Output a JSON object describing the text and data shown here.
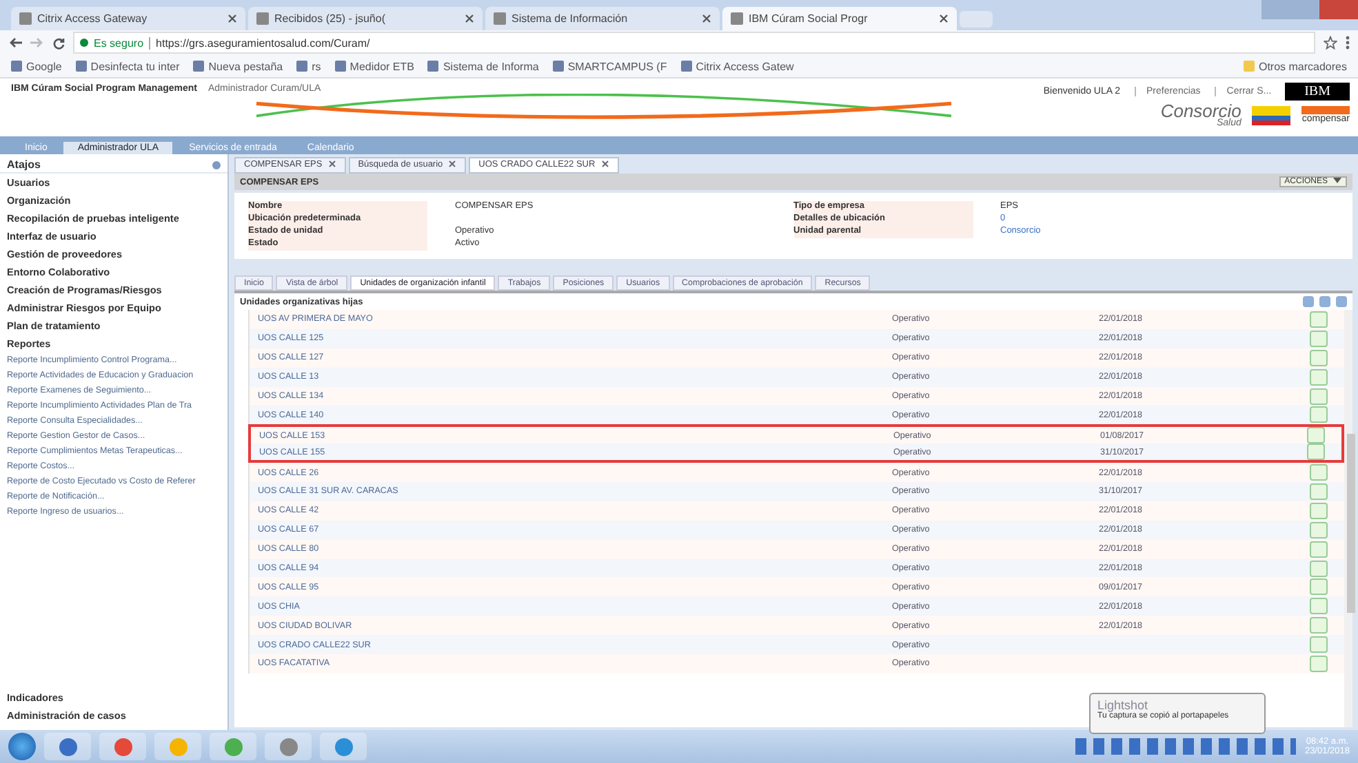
{
  "browser": {
    "tabs": [
      {
        "label": "Citrix Access Gateway",
        "selected": false
      },
      {
        "label": "Recibidos (25) - jsuño(",
        "selected": false
      },
      {
        "label": "Sistema de Información",
        "selected": false
      },
      {
        "label": "IBM Cúram Social Progr",
        "selected": true
      }
    ],
    "secure_label": "Es seguro",
    "url": "https://grs.aseguramientosalud.com/Curam/",
    "bookmarks": [
      "Google",
      "Desinfecta tu inter",
      "Nueva pestaña",
      "rs",
      "Medidor ETB",
      "Sistema de Informa",
      "SMARTCAMPUS (F",
      "Citrix Access Gatew"
    ],
    "other_bookmarks": "Otros marcadores"
  },
  "app": {
    "title": "IBM Cúram Social Program Management",
    "subtitle": "Administrador Curam/ULA",
    "welcome": "Bienvenido ULA 2",
    "links": [
      "Preferencias",
      "Cerrar S..."
    ],
    "vendor_logo": "IBM",
    "brand_logo": "Consorcio",
    "brand_logo_sub": "Salud",
    "partner_logo": "compensar",
    "nav_tabs": [
      {
        "label": "Inicio",
        "selected": false
      },
      {
        "label": "Administrador ULA",
        "selected": true
      },
      {
        "label": "Servicios de entrada",
        "selected": false
      },
      {
        "label": "Calendario",
        "selected": false
      }
    ]
  },
  "sidebar": {
    "title": "Atajos",
    "sections": [
      "Usuarios",
      "Organización",
      "Recopilación de pruebas inteligente",
      "Interfaz de usuario",
      "Gestión de proveedores",
      "Entorno Colaborativo",
      "Creación de Programas/Riesgos",
      "Administrar Riesgos por Equipo",
      "Plan de tratamiento",
      "Reportes"
    ],
    "reports": [
      "Reporte Incumplimiento Control Programa...",
      "Reporte Actividades de Educacion y Graduacion",
      "Reporte Examenes de Seguimiento...",
      "Reporte Incumplimiento Actividades Plan de Tra",
      "Reporte Consulta Especialidades...",
      "Reporte Gestion Gestor de Casos...",
      "Reporte Cumplimientos Metas Terapeuticas...",
      "Reporte Costos...",
      "Reporte de Costo Ejecutado vs Costo de Referer",
      "Reporte de Notificación...",
      "Reporte Ingreso de usuarios..."
    ],
    "bottom_sections": [
      "Indicadores",
      "Administración de casos"
    ]
  },
  "content": {
    "tabs": [
      {
        "label": "COMPENSAR EPS",
        "selected": false
      },
      {
        "label": "Búsqueda de usuario",
        "selected": false
      },
      {
        "label": "UOS CRADO CALLE22 SUR",
        "selected": true
      }
    ],
    "panel_title": "COMPENSAR EPS",
    "actions_button": "ACCIONES",
    "fields_left": [
      {
        "label": "Nombre",
        "value": "COMPENSAR EPS"
      },
      {
        "label": "Ubicación predeterminada"
      },
      {
        "label": "Estado de unidad",
        "value": "Operativo"
      },
      {
        "label": "Estado",
        "value": "Activo"
      }
    ],
    "fields_right": [
      {
        "label": "Tipo de empresa",
        "value": "EPS",
        "link": false
      },
      {
        "label": "Detalles de ubicación",
        "value": "0",
        "link": true
      },
      {
        "label": "Unidad parental",
        "value": "Consorcio",
        "link": true
      }
    ],
    "sub_tabs": [
      {
        "label": "Inicio",
        "selected": false
      },
      {
        "label": "Vista de árbol",
        "selected": false
      },
      {
        "label": "Unidades de organización infantil",
        "selected": true
      },
      {
        "label": "Trabajos",
        "selected": false
      },
      {
        "label": "Posiciones",
        "selected": false
      },
      {
        "label": "Usuarios",
        "selected": false
      },
      {
        "label": "Comprobaciones de aprobación",
        "selected": false
      },
      {
        "label": "Recursos",
        "selected": false
      }
    ],
    "section_title": "Unidades organizativas hijas",
    "rows": [
      {
        "name": "UOS AV PRIMERA DE MAYO",
        "status": "Operativo",
        "date": "22/01/2018",
        "highlighted": false
      },
      {
        "name": "UOS CALLE 125",
        "status": "Operativo",
        "date": "22/01/2018",
        "highlighted": false
      },
      {
        "name": "UOS CALLE 127",
        "status": "Operativo",
        "date": "22/01/2018",
        "highlighted": false
      },
      {
        "name": "UOS CALLE 13",
        "status": "Operativo",
        "date": "22/01/2018",
        "highlighted": false
      },
      {
        "name": "UOS CALLE 134",
        "status": "Operativo",
        "date": "22/01/2018",
        "highlighted": false
      },
      {
        "name": "UOS CALLE 140",
        "status": "Operativo",
        "date": "22/01/2018",
        "highlighted": false
      },
      {
        "name": "UOS CALLE 153",
        "status": "Operativo",
        "date": "01/08/2017",
        "highlighted": true
      },
      {
        "name": "UOS CALLE 155",
        "status": "Operativo",
        "date": "31/10/2017",
        "highlighted": true
      },
      {
        "name": "UOS CALLE 26",
        "status": "Operativo",
        "date": "22/01/2018",
        "highlighted": false
      },
      {
        "name": "UOS CALLE 31 SUR AV. CARACAS",
        "status": "Operativo",
        "date": "31/10/2017",
        "highlighted": false
      },
      {
        "name": "UOS CALLE 42",
        "status": "Operativo",
        "date": "22/01/2018",
        "highlighted": false
      },
      {
        "name": "UOS CALLE 67",
        "status": "Operativo",
        "date": "22/01/2018",
        "highlighted": false
      },
      {
        "name": "UOS CALLE 80",
        "status": "Operativo",
        "date": "22/01/2018",
        "highlighted": false
      },
      {
        "name": "UOS CALLE 94",
        "status": "Operativo",
        "date": "22/01/2018",
        "highlighted": false
      },
      {
        "name": "UOS CALLE 95",
        "status": "Operativo",
        "date": "09/01/2017",
        "highlighted": false
      },
      {
        "name": "UOS CHIA",
        "status": "Operativo",
        "date": "22/01/2018",
        "highlighted": false
      },
      {
        "name": "UOS CIUDAD BOLIVAR",
        "status": "Operativo",
        "date": "22/01/2018",
        "highlighted": false
      },
      {
        "name": "UOS CRADO CALLE22 SUR",
        "status": "Operativo",
        "highlighted": false
      },
      {
        "name": "UOS FACATATIVA",
        "status": "Operativo",
        "highlighted": false
      }
    ]
  },
  "notification": {
    "title": "Lightshot",
    "message": "Tu captura se copió al portapapeles"
  },
  "taskbar": {
    "time": "08:42 a.m.",
    "date": "23/01/2018"
  }
}
